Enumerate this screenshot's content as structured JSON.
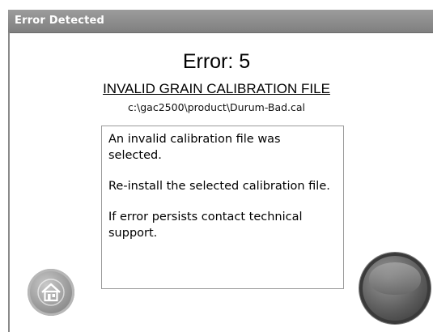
{
  "window": {
    "title": "Error Detected"
  },
  "error": {
    "code_text": "Error: 5",
    "name": "INVALID GRAIN CALIBRATION FILE",
    "path": "c:\\gac2500\\product\\Durum-Bad.cal"
  },
  "message": {
    "paragraphs": [
      "An invalid calibration file was selected.",
      "Re-install the selected calibration file.",
      "If error persists contact technical support."
    ]
  },
  "buttons": {
    "home_icon": "home-icon",
    "ok_icon": "round-ok-button"
  },
  "colors": {
    "titlebar": "#8c8c8c",
    "title_text": "#ffffff",
    "background": "#ffffff"
  }
}
